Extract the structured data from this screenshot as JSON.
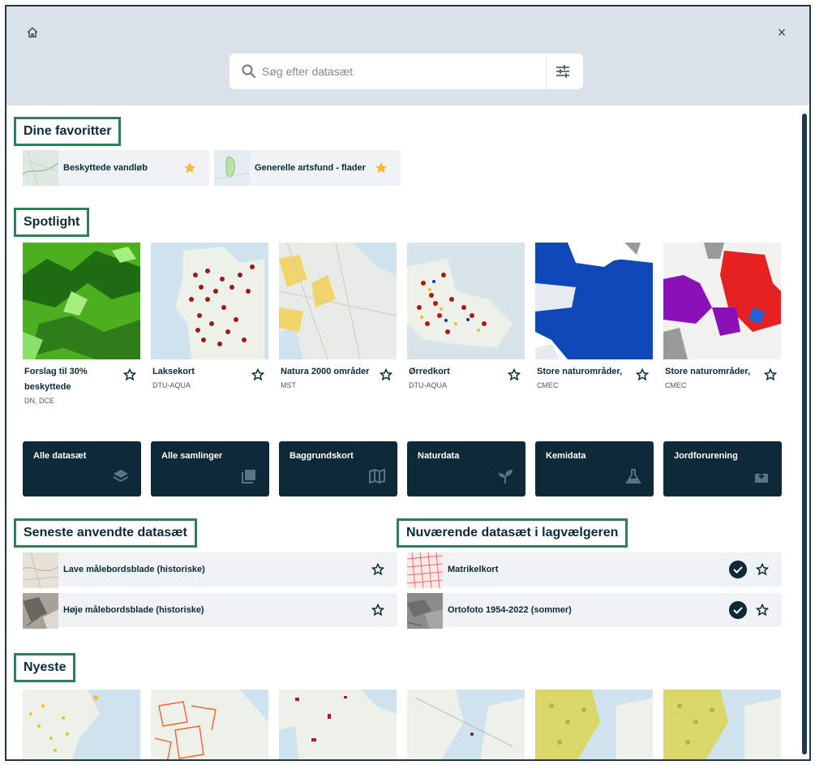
{
  "header": {
    "home_icon": "home-icon",
    "close_glyph": "×",
    "search": {
      "placeholder": "Søg efter datasæt",
      "value": ""
    },
    "filter_icon": "sliders-icon"
  },
  "favorites": {
    "title": "Dine favoritter",
    "items": [
      {
        "label": "Beskyttede vandløb"
      },
      {
        "label": "Generelle artsfund - flader"
      }
    ]
  },
  "spotlight": {
    "title": "Spotlight",
    "items": [
      {
        "title": "Forslag til 30% beskyttede",
        "org": "DN, DCE"
      },
      {
        "title": "Laksekort",
        "org": "DTU-AQUA"
      },
      {
        "title": "Natura 2000 områder",
        "org": "MST"
      },
      {
        "title": "Ørredkort",
        "org": "DTU-AQUA"
      },
      {
        "title": "Store naturområder,",
        "org": "CMEC"
      },
      {
        "title": "Store naturområder,",
        "org": "CMEC"
      }
    ]
  },
  "categories": [
    {
      "label": "Alle datasæt",
      "icon": "layers-icon"
    },
    {
      "label": "Alle samlinger",
      "icon": "collection-icon"
    },
    {
      "label": "Baggrundskort",
      "icon": "map-icon"
    },
    {
      "label": "Naturdata",
      "icon": "sprout-icon"
    },
    {
      "label": "Kemidata",
      "icon": "flask-icon"
    },
    {
      "label": "Jordforurening",
      "icon": "soil-icon"
    }
  ],
  "recent": {
    "title": "Seneste anvendte datasæt",
    "items": [
      {
        "label": "Lave målebordsblade (historiske)"
      },
      {
        "label": "Høje målebordsblade (historiske)"
      }
    ]
  },
  "current": {
    "title": "Nuværende datasæt i lagvælgeren",
    "items": [
      {
        "label": "Matrikelkort"
      },
      {
        "label": "Ortofoto 1954-2022 (sommer)"
      }
    ]
  },
  "newest": {
    "title": "Nyeste"
  },
  "colors": {
    "accent_border": "#2e7d5b",
    "dark": "#0e2a38",
    "star_fill": "#f5b82e",
    "header_bg": "#dbe3e8"
  }
}
